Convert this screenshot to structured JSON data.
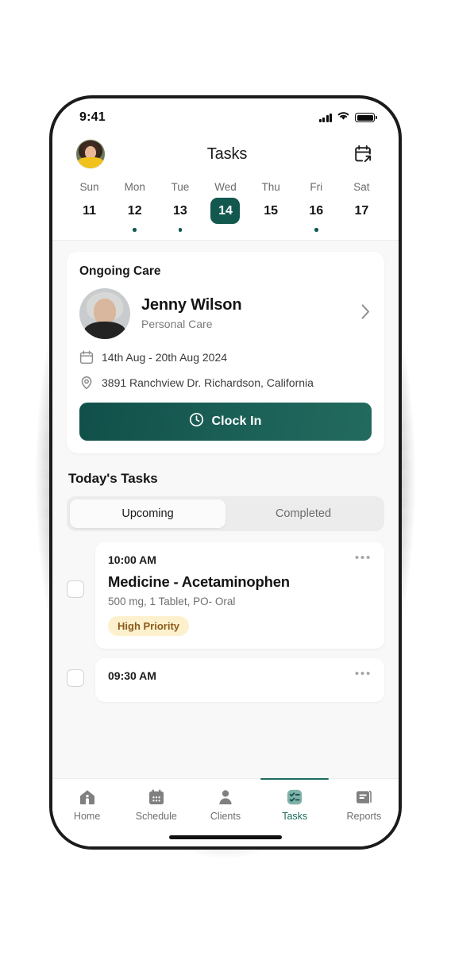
{
  "status_bar": {
    "time": "9:41",
    "signal_icon": "signal-bars-icon",
    "wifi_icon": "wifi-icon",
    "battery_icon": "battery-full-icon"
  },
  "header": {
    "title": "Tasks",
    "avatar_icon": "user-avatar",
    "calendar_share_icon": "calendar-export-icon"
  },
  "week_strip": {
    "days": [
      {
        "name": "Sun",
        "num": "11",
        "selected": false,
        "has_dot": false
      },
      {
        "name": "Mon",
        "num": "12",
        "selected": false,
        "has_dot": true
      },
      {
        "name": "Tue",
        "num": "13",
        "selected": false,
        "has_dot": true
      },
      {
        "name": "Wed",
        "num": "14",
        "selected": true,
        "has_dot": false
      },
      {
        "name": "Thu",
        "num": "15",
        "selected": false,
        "has_dot": false
      },
      {
        "name": "Fri",
        "num": "16",
        "selected": false,
        "has_dot": true
      },
      {
        "name": "Sat",
        "num": "17",
        "selected": false,
        "has_dot": false
      }
    ]
  },
  "ongoing_care": {
    "card_title": "Ongoing Care",
    "client_name": "Jenny Wilson",
    "client_role": "Personal Care",
    "client_avatar_icon": "client-photo",
    "chevron_icon": "chevron-right-icon",
    "date_range": "14th Aug - 20th Aug 2024",
    "date_icon": "calendar-icon",
    "address": "3891 Ranchview Dr. Richardson, California",
    "address_icon": "location-pin-icon",
    "clock_in_label": "Clock In",
    "clock_in_icon": "clock-icon"
  },
  "tasks_section": {
    "title": "Today's Tasks",
    "tabs": [
      {
        "label": "Upcoming",
        "active": true
      },
      {
        "label": "Completed",
        "active": false
      }
    ],
    "items": [
      {
        "time": "10:00 AM",
        "title": "Medicine - Acetaminophen",
        "subtitle": "500 mg, 1 Tablet, PO- Oral",
        "badge": "High Priority",
        "menu_icon": "more-options-icon",
        "checkbox_icon": "checkbox-unchecked"
      },
      {
        "time": "09:30 AM",
        "title": "",
        "subtitle": "",
        "badge": "",
        "menu_icon": "more-options-icon",
        "checkbox_icon": "checkbox-unchecked"
      }
    ]
  },
  "bottom_nav": {
    "items": [
      {
        "label": "Home",
        "icon": "home-icon",
        "active": false
      },
      {
        "label": "Schedule",
        "icon": "calendar-icon",
        "active": false
      },
      {
        "label": "Clients",
        "icon": "person-icon",
        "active": false
      },
      {
        "label": "Tasks",
        "icon": "checklist-icon",
        "active": true
      },
      {
        "label": "Reports",
        "icon": "document-icon",
        "active": false
      }
    ]
  },
  "colors": {
    "accent_green": "#13584f",
    "accent_green_light": "#4a9287",
    "badge_bg": "#fdf1cd",
    "badge_text": "#8a5a1c",
    "screen_bg": "#f8f8f8"
  }
}
